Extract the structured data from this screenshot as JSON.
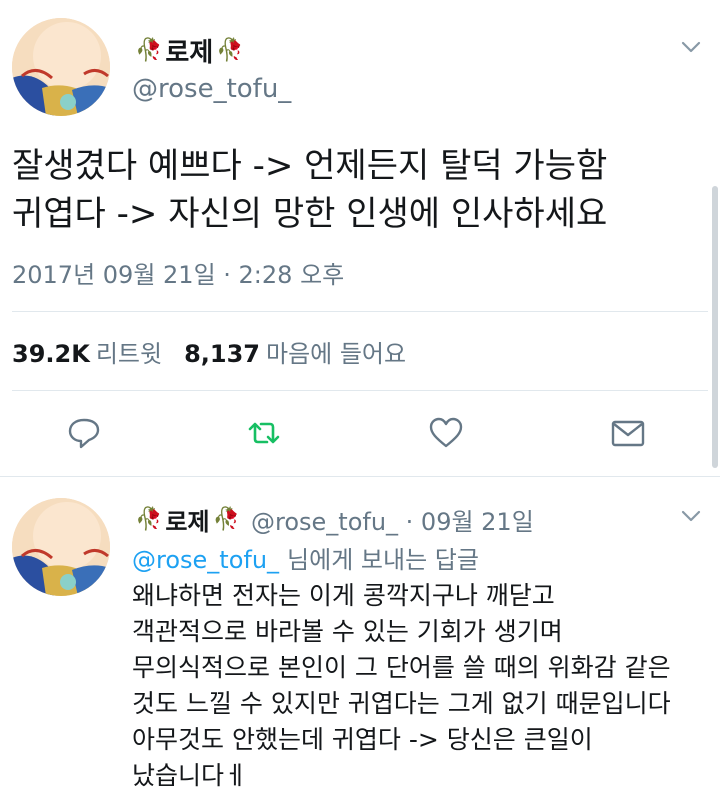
{
  "main_tweet": {
    "display_name": "로제",
    "name_emoji": "🥀",
    "handle": "@rose_tofu_",
    "text_lines": [
      "잘생겼다 예쁘다 -> 언제든지 탈덕 가능함",
      "귀엽다 -> 자신의 망한 인생에 인사하세요"
    ],
    "timestamp": "2017년 09월 21일 · 2:28 오후",
    "retweet_count": "39.2K",
    "retweet_label": "리트윗",
    "like_count": "8,137",
    "like_label": "마음에 들어요"
  },
  "actions": {
    "reply": "reply-icon",
    "retweet": "retweet-icon",
    "like": "heart-icon",
    "dm": "mail-icon",
    "retweet_color": "#17bf63"
  },
  "reply_tweet": {
    "display_name": "로제",
    "name_emoji": "🥀",
    "handle_time": "@rose_tofu_ · 09월 21일",
    "replying_mention": "@rose_tofu_",
    "replying_suffix": "님에게 보내는 답글",
    "text_lines": [
      "왜냐하면 전자는 이게 콩깍지구나 깨닫고",
      "객관적으로 바라볼 수 있는 기회가 생기며",
      "무의식적으로 본인이 그 단어를 쓸 때의 위화감 같은",
      "것도 느낄 수 있지만 귀엽다는 그게 없기 때문입니다",
      "아무것도 안했는데 귀엽다 -> 당신은 큰일이",
      "났습니다ㅔ"
    ]
  },
  "colors": {
    "text": "#14171a",
    "secondary": "#657786",
    "link": "#1da1f2",
    "rose": "#c0152a"
  }
}
